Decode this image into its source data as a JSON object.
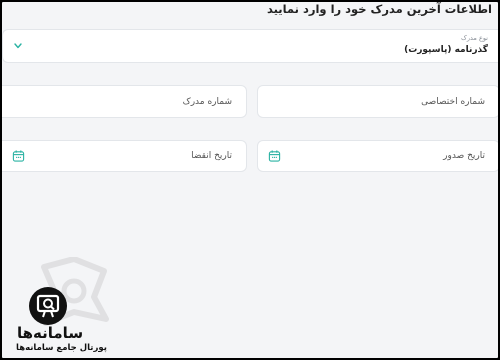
{
  "header": {
    "title": "اطلاعات آخرین مدرک خود را وارد نمایید"
  },
  "doc_type": {
    "label": "نوع مدرک",
    "value": "گذرنامه (پاسپورت)",
    "icon": "chevron-down-icon"
  },
  "fields": {
    "personal_number": {
      "placeholder": "شماره اختصاصی"
    },
    "document_number": {
      "placeholder": "شماره مدرک"
    },
    "issue_date": {
      "placeholder": "تاریخ صدور",
      "icon": "calendar-icon"
    },
    "expiry_date": {
      "placeholder": "تاریخ انقضا",
      "icon": "calendar-icon"
    }
  },
  "watermark": {
    "name": "سامانه‌ها",
    "tagline": "پورتال جامع سامانه‌ها"
  },
  "colors": {
    "accent": "#2bb3a3",
    "background": "#f4f5f7",
    "frame": "#000000"
  }
}
